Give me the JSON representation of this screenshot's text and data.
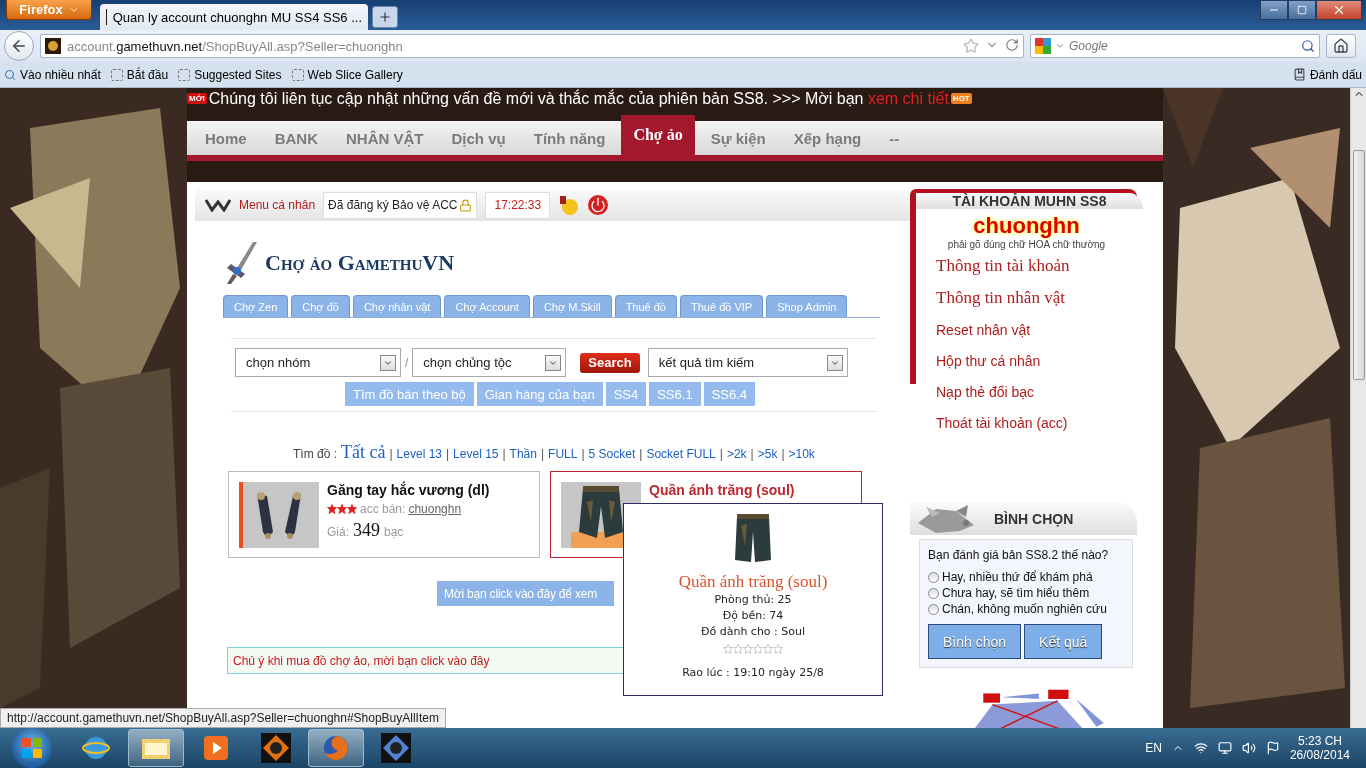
{
  "browser": {
    "menu_button": "Firefox",
    "tabs": [
      {
        "title": "Quan ly account chuonghn MU SS4 SS6 ...",
        "selected": true
      }
    ],
    "url": {
      "prefix": "account.",
      "domain": "gamethuvn.net",
      "path": "/ShopBuyAll.asp?Seller=chuonghn"
    },
    "search": {
      "placeholder": "Google"
    },
    "bookmarks": [
      "Vào nhiều nhất",
      "Bắt đầu",
      "Suggested Sites",
      "Web Slice Gallery"
    ],
    "bookmarks_menu": "Đánh dấu"
  },
  "page": {
    "announcement": {
      "badge": "MỚI",
      "text": "Chúng tôi liên tục cập nhật những vấn đề mới và thắc mắc của phiên bản SS8. >>> Mời bạn",
      "link": "xem chi tiết",
      "hot": "HOT"
    },
    "nav": [
      {
        "label": "Home",
        "selected": false
      },
      {
        "label": "BANK",
        "selected": false
      },
      {
        "label": "NHÂN VẬT",
        "selected": false
      },
      {
        "label": "Dịch vụ",
        "selected": false
      },
      {
        "label": "Tính năng",
        "selected": false
      },
      {
        "label": "Chợ ảo",
        "selected": true
      },
      {
        "label": "Sự kiện",
        "selected": false
      },
      {
        "label": "Xếp hạng",
        "selected": false
      },
      {
        "label": "--",
        "selected": false
      }
    ],
    "topbar": {
      "menu_label": "Menu cá nhân",
      "protection": "Đã đăng ký Bảo vệ ACC",
      "clock": "17:22:33"
    },
    "market": {
      "title": "Chợ ảo GamethuVN",
      "tabs": [
        {
          "label": "Chợ Zen",
          "selected": false
        },
        {
          "label": "Chợ đồ",
          "selected": false
        },
        {
          "label": "Chợ nhân vật",
          "selected": false
        },
        {
          "label": "Chợ Account",
          "selected": false
        },
        {
          "label": "Chợ M.Skill",
          "selected": false
        },
        {
          "label": "Thuê đồ",
          "selected": false
        },
        {
          "label": "Thuê đồ VIP",
          "selected": false
        },
        {
          "label": "Shop Admin",
          "selected": false
        }
      ],
      "group_select": "chọn nhóm",
      "separator": "/",
      "race_select": "chọn chủng tộc",
      "search_button": "Search",
      "result_select": "kết quả tìm kiếm",
      "quick_buttons": [
        "Tìm đồ bán theo bộ",
        "Gian hàng của bạn",
        "SS4",
        "SS6.1",
        "SS6.4"
      ],
      "filter": {
        "label": "Tìm đồ :",
        "separator": "|",
        "links": [
          {
            "label": "Tất cả",
            "selected": true
          },
          {
            "label": "Level 13",
            "selected": false
          },
          {
            "label": "Level 15",
            "selected": false
          },
          {
            "label": "Thần",
            "selected": false
          },
          {
            "label": "FULL",
            "selected": false
          },
          {
            "label": "5 Socket",
            "selected": false
          },
          {
            "label": "Socket FULL",
            "selected": false
          },
          {
            "label": ">2k",
            "selected": false
          },
          {
            "label": ">5k",
            "selected": false
          },
          {
            "label": ">10k",
            "selected": false
          }
        ]
      },
      "items": [
        {
          "kind": "gloves",
          "name": "Găng tay hắc vương (dl)",
          "stars": 3,
          "seller_label": "acc bán:",
          "seller": "chuonghn",
          "price_label": "Giá:",
          "price": "349",
          "unit": "bạc",
          "highlighted": false
        },
        {
          "kind": "pants",
          "name": "Quần ánh trăng (soul)",
          "highlighted": true
        }
      ],
      "more_button": "Mời bạn click vào đây để xem",
      "notice": "Chú ý khi mua đồ chợ ảo, mời bạn click vào đây"
    },
    "tooltip": {
      "name": "Quần ánh trăng (soul)",
      "lines": [
        "Phòng thủ: 25",
        "Độ bền: 74",
        "Đồ dành cho : Soul"
      ],
      "stars": 0,
      "posted": "Rao lúc : 19:10 ngày 25/8"
    },
    "sidebar": {
      "title": "TÀI KHOẢN MUHN SS8",
      "username": "chuonghn",
      "hint": "phải gõ đúng chữ HOA chữ thường",
      "links": [
        {
          "label": "Thông tin tài khoản",
          "kind": "major"
        },
        {
          "label": "Thông tin nhân vật",
          "kind": "major"
        },
        {
          "label": "Reset nhân vật",
          "kind": "minor"
        },
        {
          "label": "Hộp thư cá nhân",
          "kind": "minor"
        },
        {
          "label": "Nạp thẻ đổi bạc",
          "kind": "minor"
        },
        {
          "label": "Thoát tài khoản (acc)",
          "kind": "minor"
        }
      ],
      "vote": {
        "title": "BÌNH CHỌN",
        "question": "Bạn đánh giá bản SS8.2 thế nào?",
        "options": [
          {
            "label": "Hay, nhiều thứ để khám phá",
            "selected": false
          },
          {
            "label": "Chưa hay, sẽ tìm hiểu thêm",
            "selected": false
          },
          {
            "label": "Chán, không muốn nghiên cứu",
            "selected": false
          }
        ],
        "buttons": [
          "Bình chọn",
          "Kết quả"
        ]
      }
    }
  },
  "status_url": "http://account.gamethuvn.net/ShopBuyAll.asp?Seller=chuonghn#ShopBuyAllItem",
  "taskbar": {
    "apps": [
      {
        "kind": "browser-ie",
        "active": false
      },
      {
        "kind": "folder",
        "active": true
      },
      {
        "kind": "media",
        "active": false
      },
      {
        "kind": "game",
        "active": false
      },
      {
        "kind": "firefox",
        "active": true
      },
      {
        "kind": "game2",
        "active": false
      }
    ],
    "language": "EN",
    "time": "5:23 CH",
    "date": "26/08/2014"
  }
}
